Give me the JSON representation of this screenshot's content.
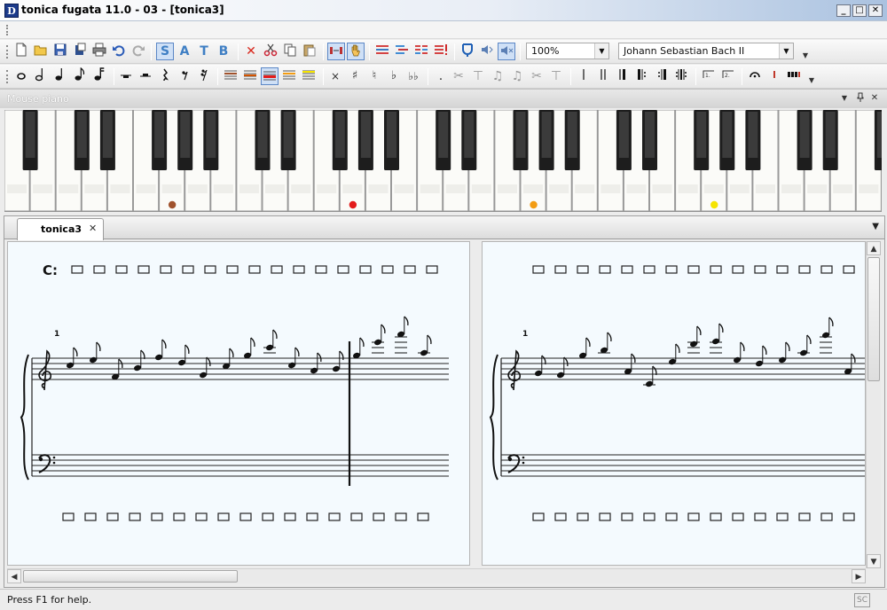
{
  "window": {
    "title": "tonica fugata 11.0 - 03 - [tonica3]",
    "icon_label": "D",
    "minimize_label": "_",
    "maximize_label": "□",
    "close_label": "✕"
  },
  "toolbar_top": {
    "voice_buttons": [
      "S",
      "A",
      "T",
      "B"
    ],
    "zoom_value": "100%",
    "style_value": "Johann Sebastian Bach II"
  },
  "mouse_piano": {
    "title": "Mouse piano",
    "markers": [
      {
        "white_key_index": 6,
        "color": "#a0522d"
      },
      {
        "white_key_index": 13,
        "color": "#e31b1b"
      },
      {
        "white_key_index": 20,
        "color": "#f39c12"
      },
      {
        "white_key_index": 27,
        "color": "#f5e400"
      }
    ]
  },
  "document": {
    "tab_label": "tonica3",
    "tab_close": "✕",
    "chord_label": "C:",
    "measure_number_left": "1",
    "measure_number_right": "1"
  },
  "statusbar": {
    "text": "Press F1 for help.",
    "indicator": "SC"
  }
}
